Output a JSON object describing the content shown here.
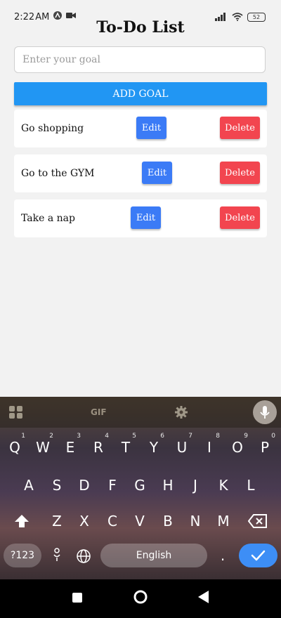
{
  "status_bar": {
    "time": "2:22",
    "am_pm": "AM",
    "battery": "52"
  },
  "app": {
    "title": "To-Do List",
    "input": {
      "placeholder": "Enter your goal",
      "value": ""
    },
    "add_button": "ADD GOAL",
    "goals": [
      {
        "text": "Go shopping",
        "edit": "Edit",
        "delete": "Delete"
      },
      {
        "text": "Go to the GYM",
        "edit": "Edit",
        "delete": "Delete"
      },
      {
        "text": "Take a nap",
        "edit": "Edit",
        "delete": "Delete"
      }
    ]
  },
  "keyboard": {
    "toolbar": {
      "grid_icon": "apps-grid-icon",
      "gif": "GIF",
      "settings_icon": "gear-icon",
      "mic_icon": "microphone-icon"
    },
    "row1": [
      {
        "key": "Q",
        "hint": "1"
      },
      {
        "key": "W",
        "hint": "2"
      },
      {
        "key": "E",
        "hint": "3"
      },
      {
        "key": "R",
        "hint": "4"
      },
      {
        "key": "T",
        "hint": "5"
      },
      {
        "key": "Y",
        "hint": "6"
      },
      {
        "key": "U",
        "hint": "7"
      },
      {
        "key": "I",
        "hint": "8"
      },
      {
        "key": "O",
        "hint": "9"
      },
      {
        "key": "P",
        "hint": "0"
      }
    ],
    "row2": [
      "A",
      "S",
      "D",
      "F",
      "G",
      "H",
      "J",
      "K",
      "L"
    ],
    "row3": [
      "Z",
      "X",
      "C",
      "V",
      "B",
      "N",
      "M"
    ],
    "symbols_key": "?123",
    "space_label": "English",
    "period_key": ".",
    "shift_icon": "shift-icon",
    "backspace_icon": "backspace-icon",
    "emoji_icon": "emoji-icon",
    "globe_icon": "globe-icon",
    "enter_icon": "checkmark-icon"
  },
  "nav_bar": {
    "recents_icon": "square-icon",
    "home_icon": "circle-icon",
    "back_icon": "back-triangle-icon"
  },
  "colors": {
    "add_button": "#2196f3",
    "edit_button": "#3b7bf6",
    "delete_button": "#f2454f",
    "enter_key": "#3d8ef6"
  }
}
